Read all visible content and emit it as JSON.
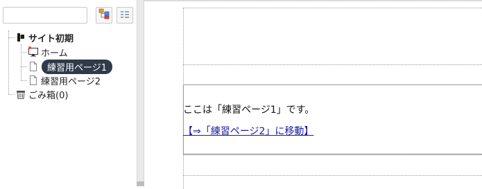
{
  "sidebar": {
    "search": {
      "value": "",
      "placeholder": ""
    },
    "tree": {
      "root": {
        "label": "サイト初期",
        "icon": "site-root-icon"
      },
      "items": [
        {
          "label": "ホーム",
          "icon": "monitor-icon"
        },
        {
          "label": "練習用ページ1",
          "icon": "page-icon",
          "selected": true
        },
        {
          "label": "練習用ページ2",
          "icon": "page-icon"
        }
      ],
      "trash": {
        "label": "ごみ箱(0)",
        "icon": "trash-icon"
      }
    }
  },
  "main": {
    "text": "ここは「練習ページ1」です。",
    "link": "【⇒「練習ページ2」に移動】"
  },
  "colors": {
    "selected_bg": "#2f3a4a",
    "link": "#1a1aa6"
  }
}
